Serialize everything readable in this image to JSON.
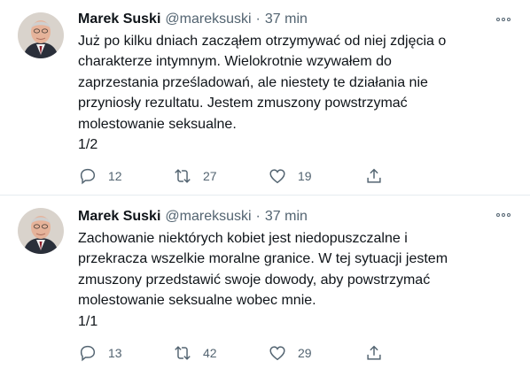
{
  "tweets": [
    {
      "author_name": "Marek Suski",
      "handle": "@mareksuski",
      "separator": "·",
      "time": "37 min",
      "text": "Już po kilku dniach zacząłem otrzymywać od niej zdjęcia o\ncharakterze intymnym. Wielokrotnie wzywałem do\nzaprzestania prześladowań, ale niestety te działania nie\nprzyniosły rezultatu. Jestem zmuszony powstrzymać\nmolestowanie seksualne.\n1/2",
      "replies": "12",
      "retweets": "27",
      "likes": "19"
    },
    {
      "author_name": "Marek Suski",
      "handle": "@mareksuski",
      "separator": "·",
      "time": "37 min",
      "text": "Zachowanie niektórych kobiet jest niedopuszczalne i\nprzekracza wszelkie moralne granice. W tej sytuacji jestem\nzmuszony przedstawić swoje dowody, aby powstrzymać\nmolestowanie seksualne wobec mnie.\n1/1",
      "replies": "13",
      "retweets": "42",
      "likes": "29"
    }
  ],
  "icons": {
    "reply": "reply-icon",
    "retweet": "retweet-icon",
    "like": "heart-icon",
    "share": "share-icon",
    "more": "more-options-icon"
  },
  "colors": {
    "text": "#0f1419",
    "secondary": "#536471",
    "divider": "#e6ecf0"
  }
}
